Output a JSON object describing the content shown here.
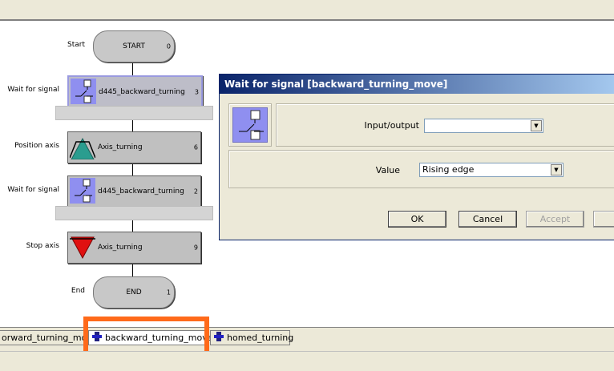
{
  "flow": {
    "start": {
      "label": "Start",
      "text": "START",
      "num": "0"
    },
    "steps": [
      {
        "label": "Wait for signal",
        "text": "d445_backward_turning",
        "num": "3",
        "icon": "signal-switch-icon"
      },
      {
        "label": "Position axis",
        "text": "Axis_turning",
        "num": "6",
        "icon": "position-axis-icon"
      },
      {
        "label": "Wait for signal",
        "text": "d445_backward_turning",
        "num": "2",
        "icon": "signal-switch-icon"
      },
      {
        "label": "Stop axis",
        "text": "Axis_turning",
        "num": "9",
        "icon": "stop-axis-icon"
      }
    ],
    "end": {
      "label": "End",
      "text": "END",
      "num": "1"
    }
  },
  "dialog": {
    "title": "Wait for signal [backward_turning_move]",
    "io_label": "Input/output",
    "io_value": "",
    "value_label": "Value",
    "value_value": "Rising edge",
    "buttons": {
      "ok": "OK",
      "cancel": "Cancel",
      "accept": "Accept"
    }
  },
  "tabs": [
    {
      "label": "orward_turning_move"
    },
    {
      "label": "backward_turning_move",
      "active": true
    },
    {
      "label": "homed_turning"
    }
  ],
  "colors": {
    "highlight": "#ff6a1a",
    "title_start": "#0a246a",
    "title_end": "#a6caf0"
  }
}
